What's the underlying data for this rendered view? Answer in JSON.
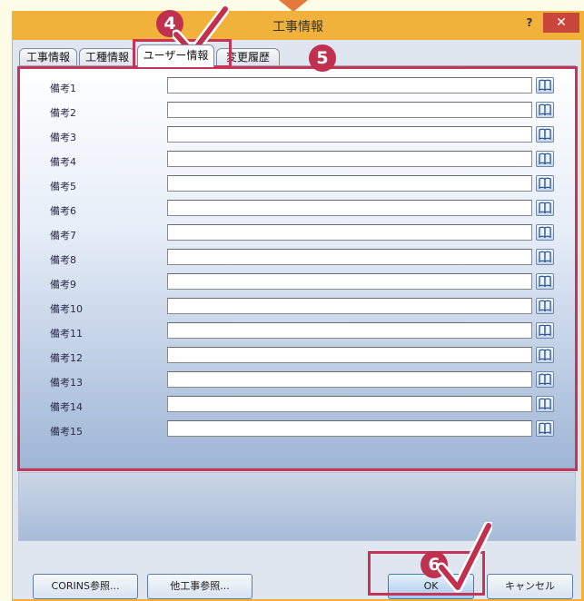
{
  "window": {
    "title": "工事情報",
    "help_label": "?",
    "close_label": "✕"
  },
  "tabs": [
    {
      "label": "工事情報",
      "active": false
    },
    {
      "label": "工種情報",
      "active": false
    },
    {
      "label": "ユーザー情報",
      "active": true
    },
    {
      "label": "変更履歴",
      "active": false
    }
  ],
  "fields": [
    {
      "label": "備考1",
      "value": ""
    },
    {
      "label": "備考2",
      "value": ""
    },
    {
      "label": "備考3",
      "value": ""
    },
    {
      "label": "備考4",
      "value": ""
    },
    {
      "label": "備考5",
      "value": ""
    },
    {
      "label": "備考6",
      "value": ""
    },
    {
      "label": "備考7",
      "value": ""
    },
    {
      "label": "備考8",
      "value": ""
    },
    {
      "label": "備考9",
      "value": ""
    },
    {
      "label": "備考10",
      "value": ""
    },
    {
      "label": "備考11",
      "value": ""
    },
    {
      "label": "備考12",
      "value": ""
    },
    {
      "label": "備考13",
      "value": ""
    },
    {
      "label": "備考14",
      "value": ""
    },
    {
      "label": "備考15",
      "value": ""
    }
  ],
  "field_button_icon": "book-icon",
  "buttons": {
    "corins": "CORINS参照...",
    "other_work": "他工事参照...",
    "ok": "OK",
    "cancel": "キャンセル"
  },
  "callouts": {
    "step4": "4",
    "step5": "5",
    "step6": "6"
  },
  "colors": {
    "highlight": "#c4355a",
    "window_frame": "#f1b23c",
    "close_button": "#c9473a"
  }
}
